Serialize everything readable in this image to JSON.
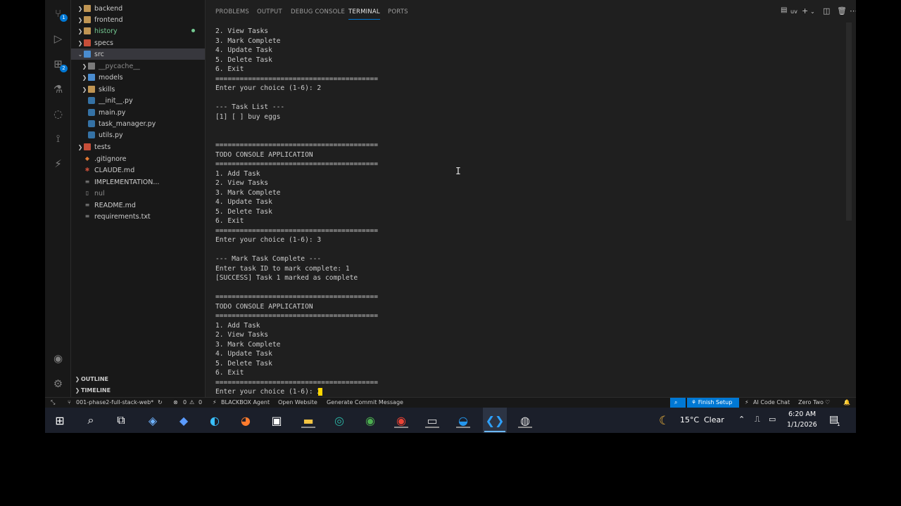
{
  "activity_bar": {
    "source_control_badge": "1",
    "extensions_badge": "2"
  },
  "explorer": {
    "items": [
      {
        "label": "backend",
        "icon": "folder-icon",
        "expandable": true
      },
      {
        "label": "frontend",
        "icon": "folder-icon",
        "expandable": true
      },
      {
        "label": "history",
        "icon": "folder-icon",
        "expandable": true
      },
      {
        "label": "specs",
        "icon": "folder-special-icon",
        "expandable": true
      },
      {
        "label": "src",
        "icon": "folder-src-icon",
        "expandable": true
      },
      {
        "label": "__pycache__",
        "icon": "folder-pycache-icon",
        "expandable": true
      },
      {
        "label": "models",
        "icon": "folder-models-icon",
        "expandable": true
      },
      {
        "label": "skills",
        "icon": "folder-icon",
        "expandable": true
      },
      {
        "label": "__init__.py",
        "icon": "python-file-icon"
      },
      {
        "label": "main.py",
        "icon": "python-file-icon"
      },
      {
        "label": "task_manager.py",
        "icon": "python-file-icon"
      },
      {
        "label": "utils.py",
        "icon": "python-file-icon"
      },
      {
        "label": "tests",
        "icon": "folder-tests-icon",
        "expandable": true
      },
      {
        "label": ".gitignore",
        "icon": "git-file-icon"
      },
      {
        "label": "CLAUDE.md",
        "icon": "markdown-file-icon"
      },
      {
        "label": "IMPLEMENTATION...",
        "icon": "text-file-icon"
      },
      {
        "label": "nul",
        "icon": "blank-file-icon"
      },
      {
        "label": "README.md",
        "icon": "markdown-file-icon"
      },
      {
        "label": "requirements.txt",
        "icon": "text-file-icon"
      }
    ],
    "outline_label": "OUTLINE",
    "timeline_label": "TIMELINE"
  },
  "panel": {
    "tabs": [
      "PROBLEMS",
      "OUTPUT",
      "DEBUG CONSOLE",
      "TERMINAL",
      "PORTS"
    ],
    "active_tab": "TERMINAL",
    "shell_label": "uv"
  },
  "terminal": {
    "lines": [
      "2. View Tasks",
      "3. Mark Complete",
      "4. Update Task",
      "5. Delete Task",
      "6. Exit",
      "========================================",
      "Enter your choice (1-6): 2",
      "",
      "--- Task List ---",
      "[1] [ ] buy eggs",
      "",
      "",
      "========================================",
      "TODO CONSOLE APPLICATION",
      "========================================",
      "1. Add Task",
      "2. View Tasks",
      "3. Mark Complete",
      "4. Update Task",
      "5. Delete Task",
      "6. Exit",
      "========================================",
      "Enter your choice (1-6): 3",
      "",
      "--- Mark Task Complete ---",
      "Enter task ID to mark complete: 1",
      "[SUCCESS] Task 1 marked as complete",
      "",
      "========================================",
      "TODO CONSOLE APPLICATION",
      "========================================",
      "1. Add Task",
      "2. View Tasks",
      "3. Mark Complete",
      "4. Update Task",
      "5. Delete Task",
      "6. Exit",
      "========================================",
      "Enter your choice (1-6): 2"
    ]
  },
  "status_bar": {
    "branch": "001-phase2-full-stack-web*",
    "errors": "0",
    "warnings": "0",
    "blackbox": "BLACKBOX Agent",
    "open_website": "Open Website",
    "commit_msg": "Generate Commit Message",
    "finish_setup": "Finish Setup",
    "ai_chat": "AI Code Chat",
    "profile": "Zero Two"
  },
  "taskbar": {
    "weather_temp": "15°C",
    "weather_desc": "Clear",
    "time": "6:20 AM",
    "date": "1/1/2026",
    "notification_count": "1"
  },
  "colors": {
    "accent": "#0078d4",
    "cursor": "#ffd700",
    "git_added": "#73c991"
  }
}
